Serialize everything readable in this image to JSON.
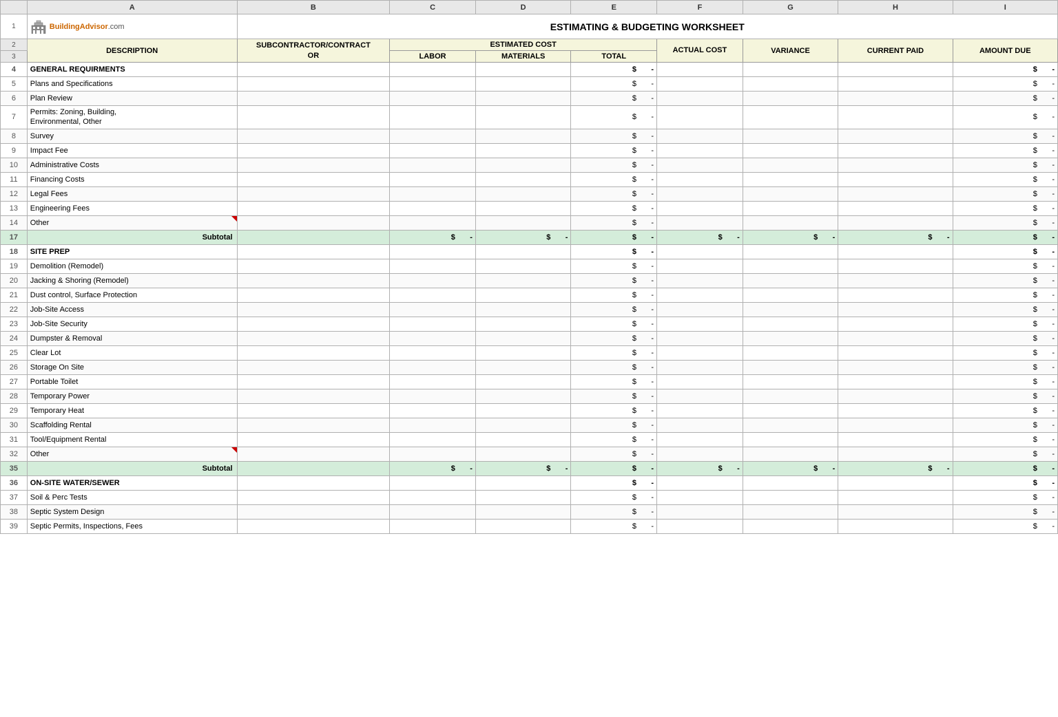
{
  "title": "ESTIMATING & BUDGETING WORKSHEET",
  "logo": {
    "brand": "BuildingAdvisor",
    "suffix": ".com"
  },
  "columns": {
    "letters": [
      "",
      "A",
      "B",
      "C",
      "D",
      "E",
      "F",
      "G",
      "H",
      "I"
    ],
    "headers": {
      "row2": {
        "description": "DESCRIPTION",
        "subcontractor": "SUBCONTRACTOR/CONTRACT",
        "estimated": "ESTIMATED COST",
        "actual": "ACTUAL COST",
        "variance": "VARIANCE",
        "current_paid": "CURRENT PAID",
        "amount_due": "AMOUNT DUE"
      },
      "row3": {
        "sub_or": "OR",
        "labor": "LABOR",
        "materials": "MATERIALS",
        "total": "TOTAL"
      }
    }
  },
  "sections": [
    {
      "id": "general",
      "row_num": "4",
      "title": "GENERAL REQUIRMENTS",
      "items": [
        {
          "row": "5",
          "desc": "Plans and Specifications"
        },
        {
          "row": "6",
          "desc": "Plan Review"
        },
        {
          "row": "7",
          "desc": "Permits: Zoning, Building,\nEnvironmental, Other",
          "two_line": true
        },
        {
          "row": "8",
          "desc": "Survey"
        },
        {
          "row": "9",
          "desc": "Impact Fee"
        },
        {
          "row": "10",
          "desc": "Administrative Costs"
        },
        {
          "row": "11",
          "desc": "Financing Costs"
        },
        {
          "row": "12",
          "desc": "Legal Fees"
        },
        {
          "row": "13",
          "desc": "Engineering Fees"
        },
        {
          "row": "14",
          "desc": "Other",
          "red_triangle": true
        }
      ],
      "subtotal_row": "17"
    },
    {
      "id": "site_prep",
      "row_num": "18",
      "title": "SITE PREP",
      "items": [
        {
          "row": "19",
          "desc": "Demolition (Remodel)"
        },
        {
          "row": "20",
          "desc": "Jacking & Shoring (Remodel)"
        },
        {
          "row": "21",
          "desc": "Dust control, Surface Protection"
        },
        {
          "row": "22",
          "desc": "Job-Site Access"
        },
        {
          "row": "23",
          "desc": "Job-Site Security"
        },
        {
          "row": "24",
          "desc": "Dumpster & Removal"
        },
        {
          "row": "25",
          "desc": "Clear Lot"
        },
        {
          "row": "26",
          "desc": "Storage On Site"
        },
        {
          "row": "27",
          "desc": "Portable Toilet"
        },
        {
          "row": "28",
          "desc": "Temporary Power"
        },
        {
          "row": "29",
          "desc": "Temporary Heat"
        },
        {
          "row": "30",
          "desc": "Scaffolding Rental"
        },
        {
          "row": "31",
          "desc": "Tool/Equipment Rental"
        },
        {
          "row": "32",
          "desc": "Other",
          "red_triangle": true
        }
      ],
      "subtotal_row": "35"
    },
    {
      "id": "onsite_water",
      "row_num": "36",
      "title": "ON-SITE WATER/SEWER",
      "items": [
        {
          "row": "37",
          "desc": "Soil & Perc Tests"
        },
        {
          "row": "38",
          "desc": "Septic System Design"
        },
        {
          "row": "39",
          "desc": "Septic Permits, Inspections, Fees"
        }
      ]
    }
  ],
  "dollar_symbol": "$",
  "dash": "-",
  "subtotal_label": "Subtotal"
}
